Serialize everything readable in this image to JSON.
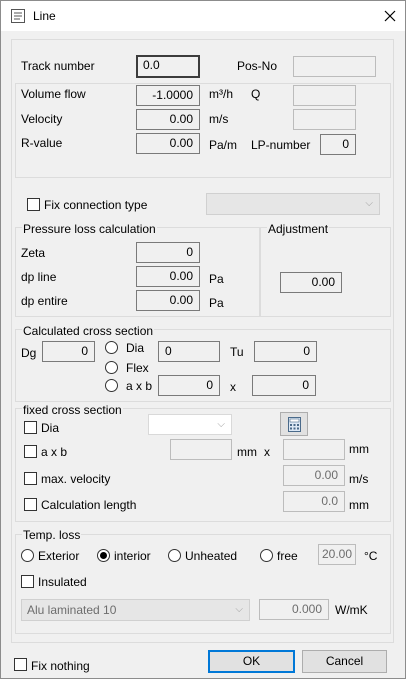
{
  "window": {
    "title": "Line"
  },
  "track": {
    "label": "Track number",
    "value": "0.0",
    "posno_label": "Pos-No",
    "posno_value": ""
  },
  "flow": {
    "volume_label": "Volume flow",
    "volume_value": "-1.0000",
    "volume_unit": "m³/h",
    "q_label": "Q",
    "q_value": "",
    "velocity_label": "Velocity",
    "velocity_value": "0.00",
    "velocity_unit": "m/s",
    "velocity_extra_value": "",
    "rvalue_label": "R-value",
    "rvalue_value": "0.00",
    "rvalue_unit": "Pa/m",
    "lp_label": "LP-number",
    "lp_value": "0"
  },
  "fix_connection": {
    "label": "Fix connection type",
    "checked": false,
    "combo_value": ""
  },
  "pressure_loss": {
    "title": "Pressure loss calculation",
    "zeta_label": "Zeta",
    "zeta_value": "0",
    "dpline_label": "dp line",
    "dpline_value": "0.00",
    "dpline_unit": "Pa",
    "dpentire_label": "dp entire",
    "dpentire_value": "0.00",
    "dpentire_unit": "Pa"
  },
  "adjustment": {
    "title": "Adjustment",
    "value": "0.00"
  },
  "calc_cross": {
    "title": "Calculated cross section",
    "dg_label": "Dg",
    "dg_value": "0",
    "dia_label": "Dia",
    "dia_value": "0",
    "tu_label": "Tu",
    "tu_value": "0",
    "flex_label": "Flex",
    "axb_label": "a x b",
    "a_value": "0",
    "x_label": "x",
    "b_value": "0"
  },
  "fixed_cross": {
    "title": "fixed cross section",
    "dia_label": "Dia",
    "dia_combo": "",
    "axb_label": "a x b",
    "a_value": "",
    "mm_label1": "mm",
    "x_label": "x",
    "b_value": "",
    "mm_label2": "mm",
    "maxvel_label": "max. velocity",
    "maxvel_value": "0.00",
    "maxvel_unit": "m/s",
    "calclen_label": "Calculation length",
    "calclen_value": "0.0",
    "calclen_unit": "mm"
  },
  "temp_loss": {
    "title": "Temp. loss",
    "exterior_label": "Exterior",
    "interior_label": "interior",
    "unheated_label": "Unheated",
    "free_label": "free",
    "selected": "interior",
    "temp_value": "20.00",
    "temp_unit": "°C",
    "insulated_label": "Insulated",
    "material_value": "Alu laminated 10",
    "wmk_value": "0.000",
    "wmk_unit": "W/mK"
  },
  "footer": {
    "fix_nothing_label": "Fix nothing",
    "ok_label": "OK",
    "cancel_label": "Cancel"
  },
  "icons": [
    "app-icon",
    "close-icon",
    "calculator-icon",
    "chevron-down-icon"
  ]
}
